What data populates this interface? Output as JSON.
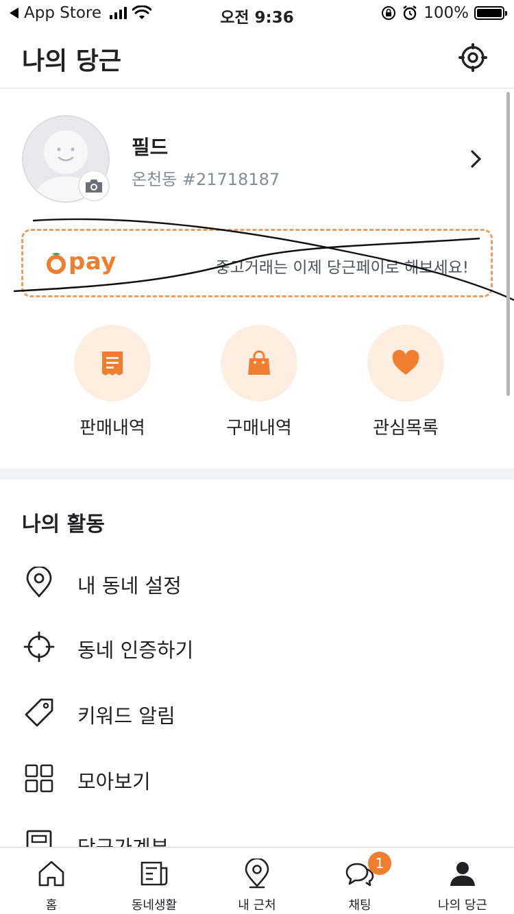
{
  "status_bar": {
    "back_label": "App Store",
    "time": "오전 9:36",
    "battery": "100%"
  },
  "header": {
    "title": "나의 당근"
  },
  "profile": {
    "name": "필드",
    "location_id": "온천동 #21718187"
  },
  "pay_banner": {
    "logo_text": "pay",
    "message": "중고거래는 이제 당근페이로 해보세요!"
  },
  "shortcuts": [
    {
      "label": "판매내역",
      "icon": "receipt-icon"
    },
    {
      "label": "구매내역",
      "icon": "shopping-bag-icon"
    },
    {
      "label": "관심목록",
      "icon": "heart-icon"
    }
  ],
  "activity": {
    "title": "나의 활동",
    "items": [
      {
        "label": "내 동네 설정",
        "icon": "location-pin-icon"
      },
      {
        "label": "동네 인증하기",
        "icon": "crosshair-icon"
      },
      {
        "label": "키워드 알림",
        "icon": "tag-icon"
      },
      {
        "label": "모아보기",
        "icon": "grid-icon"
      },
      {
        "label": "당근가계부",
        "icon": "ledger-icon"
      }
    ]
  },
  "tabbar": {
    "tabs": [
      {
        "label": "홈",
        "icon": "home-icon"
      },
      {
        "label": "동네생활",
        "icon": "newspaper-icon"
      },
      {
        "label": "내 근처",
        "icon": "location-pin-icon"
      },
      {
        "label": "채팅",
        "icon": "chat-icon",
        "badge": "1"
      },
      {
        "label": "나의 당근",
        "icon": "user-icon"
      }
    ]
  },
  "colors": {
    "accent": "#f07e2f",
    "accent_light": "#fdeee2",
    "text": "#212124",
    "subtext": "#868b94"
  }
}
